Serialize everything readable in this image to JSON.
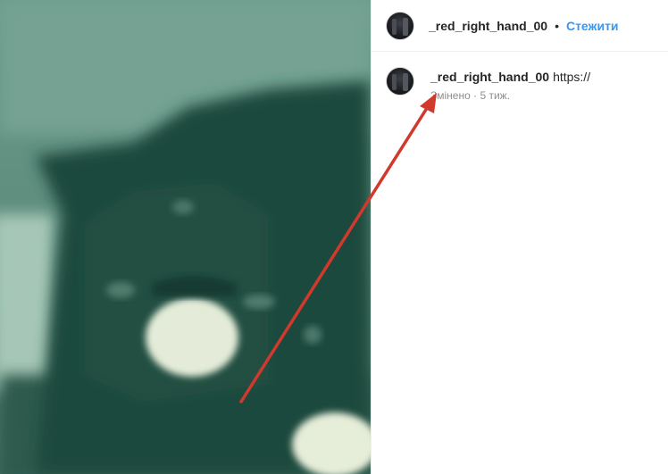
{
  "post": {
    "author": {
      "username": "_red_right_hand_00",
      "avatar_icon": "profile-avatar-icon"
    },
    "separator": "•",
    "follow_label": "Стежити",
    "follow_color": "#3897f0",
    "caption": {
      "username": "_red_right_hand_00",
      "text": "https://",
      "edited_label": "Змінено",
      "meta_separator": "·",
      "age": "5 тиж."
    }
  },
  "annotation": {
    "arrow_color": "#d0392b"
  }
}
